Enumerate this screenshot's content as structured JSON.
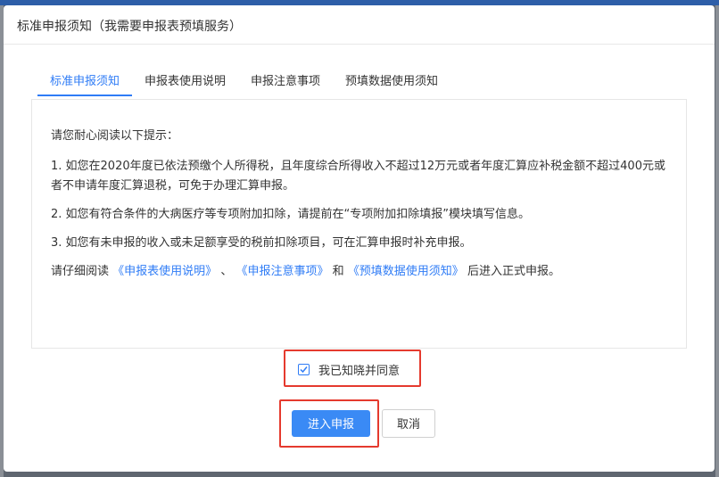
{
  "dialog": {
    "title": "标准申报须知（我需要申报表预填服务）"
  },
  "tabs": [
    {
      "label": "标准申报须知",
      "active": true
    },
    {
      "label": "申报表使用说明",
      "active": false
    },
    {
      "label": "申报注意事项",
      "active": false
    },
    {
      "label": "预填数据使用须知",
      "active": false
    }
  ],
  "content": {
    "intro": "请您耐心阅读以下提示：",
    "item1": "1. 如您在2020年度已依法预缴个人所得税，且年度综合所得收入不超过12万元或者年度汇算应补税金额不超过400元或者不申请年度汇算退税，可免于办理汇算申报。",
    "item2": "2. 如您有符合条件的大病医疗等专项附加扣除，请提前在“专项附加扣除填报”模块填写信息。",
    "item3": "3. 如您有未申报的收入或未足额享受的税前扣除项目，可在汇算申报时补充申报。",
    "read_prefix": "请仔细阅读",
    "link1": "《申报表使用说明》",
    "sep1": "、",
    "link2": "《申报注意事项》",
    "sep2": "和",
    "link3": "《预填数据使用须知》",
    "read_suffix": "后进入正式申报。"
  },
  "agree": {
    "label": "我已知晓并同意",
    "checked": true
  },
  "buttons": {
    "submit": "进入申报",
    "cancel": "取消"
  },
  "colors": {
    "accent": "#2f7cf6",
    "primary_button": "#3a8af5",
    "highlight_border": "#e53a2e"
  }
}
